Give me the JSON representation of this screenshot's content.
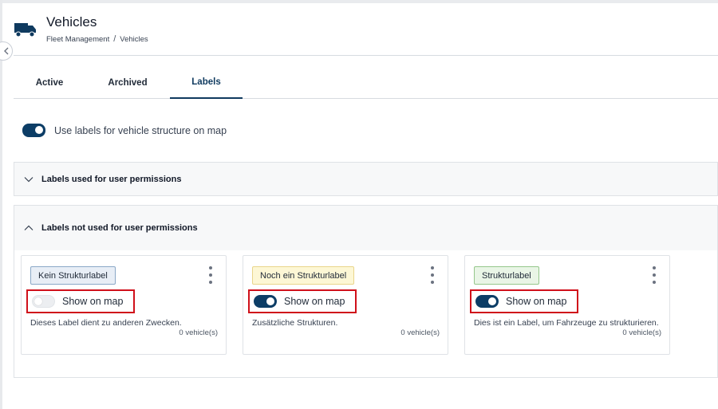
{
  "header": {
    "title": "Vehicles",
    "breadcrumb": [
      "Fleet Management",
      "/",
      "Vehicles"
    ],
    "icon": "truck-icon"
  },
  "tabs": [
    {
      "label": "Active"
    },
    {
      "label": "Archived"
    },
    {
      "label": "Labels",
      "active": true
    }
  ],
  "global_toggle": {
    "label": "Use labels for vehicle structure on map",
    "enabled": true
  },
  "sections": [
    {
      "title": "Labels used for user permissions",
      "expanded": false
    },
    {
      "title": "Labels not used for user permissions",
      "expanded": true
    }
  ],
  "cards": [
    {
      "label": "Kein Strukturlabel",
      "color": "#e8eef6",
      "show_on_map": false,
      "show_label": "Show on map",
      "description": "Dieses Label dient zu anderen Zwecken.",
      "count": "0 vehicle(s)"
    },
    {
      "label": "Noch ein Strukturlabel",
      "color": "#fdf7d5",
      "show_on_map": true,
      "show_label": "Show on map",
      "description": "Zusätzliche Strukturen.",
      "count": "0 vehicle(s)"
    },
    {
      "label": "Strukturlabel",
      "color": "#e9f5e6",
      "show_on_map": true,
      "show_label": "Show on map",
      "description": "Dies ist ein Label, um Fahrzeuge zu strukturieren.",
      "count": "0 vehicle(s)"
    }
  ],
  "colors": {
    "accent": "#0c3d66",
    "highlight": "#d0101a"
  }
}
